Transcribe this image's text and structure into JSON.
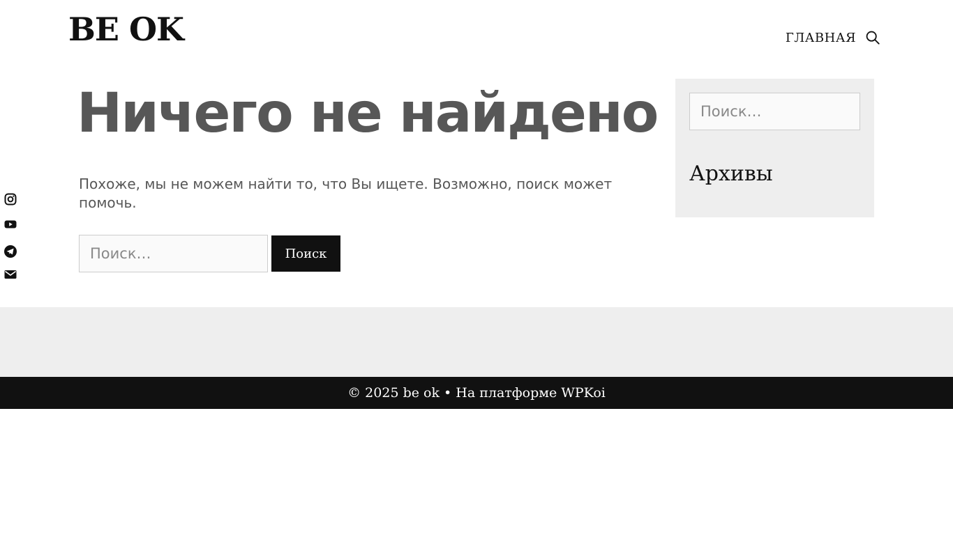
{
  "header": {
    "logo": "BE OK",
    "nav": {
      "home_label": "ГЛАВНАЯ",
      "search_icon": "search-icon"
    }
  },
  "social": [
    {
      "icon": "instagram-icon"
    },
    {
      "icon": "youtube-icon"
    },
    {
      "icon": "telegram-icon"
    },
    {
      "icon": "envelope-icon"
    }
  ],
  "main": {
    "title": "Ничего не найдено",
    "message": "Похоже, мы не можем найти то, что Вы ищете. Возможно, поиск может помочь.",
    "search": {
      "placeholder": "Поиск…",
      "button_label": "Поиск"
    }
  },
  "sidebar": {
    "search_placeholder": "Поиск…",
    "archives_heading": "Архивы"
  },
  "footer": {
    "copyright": "© 2025 be ok",
    "separator": " • ",
    "credit": "На платформе WPKoi"
  },
  "colors": {
    "text_dark": "#111111",
    "text_muted": "#575757",
    "panel_bg": "#eeeeee",
    "footer_bg": "#111111"
  }
}
